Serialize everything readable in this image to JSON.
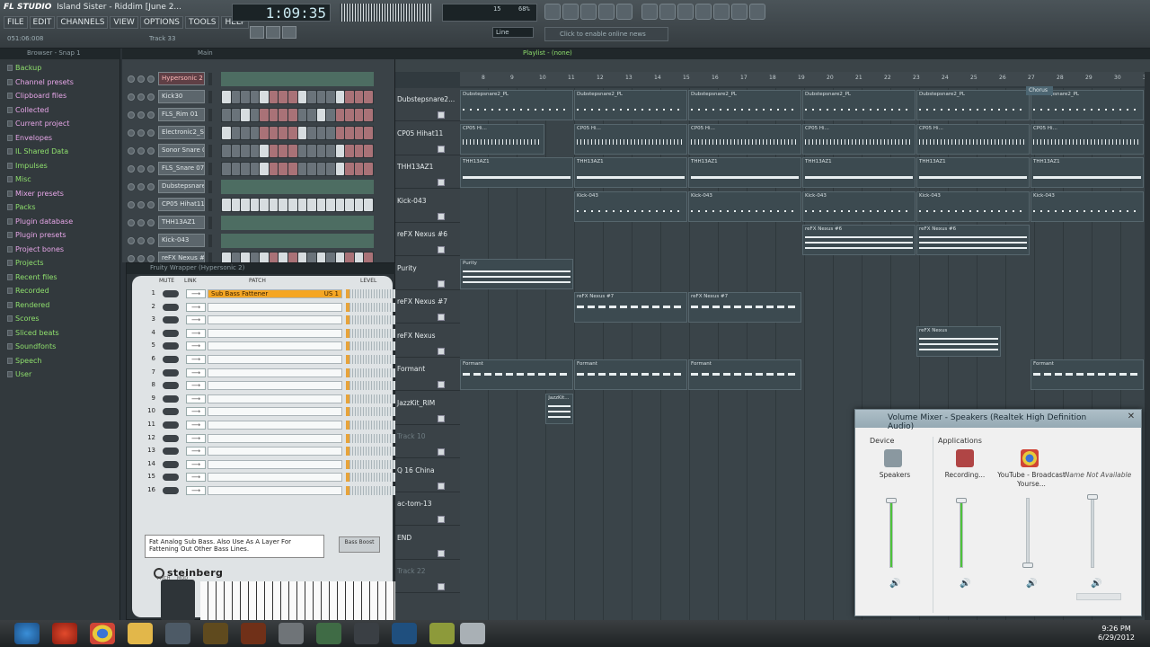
{
  "app": {
    "brand": "FL STUDIO",
    "title": "Island Sister - Riddim [June 2...",
    "time": "1:09:35",
    "status_left": "051:06:008",
    "track_label": "Track 33",
    "hint": "Click to enable online news",
    "mode": "Line",
    "meter_top": "15",
    "meter_right": "68%"
  },
  "menu": [
    "FILE",
    "EDIT",
    "CHANNELS",
    "VIEW",
    "OPTIONS",
    "TOOLS",
    "HELP"
  ],
  "browser": {
    "title": "Browser - Snap 1",
    "items": [
      "Backup",
      "Channel presets",
      "Clipboard files",
      "Collected",
      "Current project",
      "Envelopes",
      "IL Shared Data",
      "Impulses",
      "Misc",
      "Mixer presets",
      "Packs",
      "Plugin database",
      "Plugin presets",
      "Project bones",
      "Projects",
      "Recent files",
      "Recorded",
      "Rendered",
      "Scores",
      "Sliced beats",
      "Soundfonts",
      "Speech",
      "User"
    ]
  },
  "rack": {
    "title": "Main",
    "channels": [
      "Hypersonic 2",
      "Kick30",
      "FLS_Rim 01",
      "Electronic2_S...",
      "Sonor Snare 0...",
      "FLS_Snare 076",
      "Dubstepsnare...",
      "CP05 Hihat11",
      "THH13AZ1",
      "Kick-043",
      "reFX Nexus #6"
    ]
  },
  "plugin": {
    "title": "Fruity Wrapper (Hypersonic 2)",
    "col_mute": "MUTE",
    "col_link": "LINK",
    "col_patch": "PATCH",
    "col_level": "LEVEL",
    "slot1_patch": "Sub Bass Fattener",
    "slot1_bank": "US 1",
    "description": "Fat Analog Sub Bass. Also Use As A Layer For Fattening Out Other Bass Lines.",
    "preset_button": "Bass Boost",
    "logo": "steinberg",
    "pitch_label": "PITCH",
    "mod_label": "MOD",
    "slot_numbers": [
      "1",
      "2",
      "3",
      "4",
      "5",
      "6",
      "7",
      "8",
      "9",
      "10",
      "11",
      "12",
      "13",
      "14",
      "15",
      "16"
    ]
  },
  "playlist": {
    "title": "Playlist - (none)",
    "marker": "Chorus",
    "ruler": [
      "8",
      "9",
      "10",
      "11",
      "12",
      "13",
      "14",
      "15",
      "16",
      "17",
      "18",
      "19",
      "20",
      "21",
      "22",
      "23",
      "24",
      "25",
      "26",
      "27",
      "28",
      "29",
      "30",
      "31",
      "32"
    ],
    "tracks": [
      "Dubstepsnare2...",
      "CP05 Hihat11",
      "THH13AZ1",
      "Kick-043",
      "reFX Nexus #6",
      "Purity",
      "reFX Nexus #7",
      "reFX Nexus",
      "Formant",
      "JazzKit_RIM",
      "Track 10",
      "Q 16 China",
      "ac-tom-13",
      "END",
      "Track 22"
    ],
    "clip_labels": {
      "snare": "Dubstepsnare2_PL",
      "hihat": "CP05 Hi...",
      "thh": "THH13AZ1",
      "kick": "Kick-043",
      "nexus6": "reFX Nexus #6",
      "purity": "Purity",
      "nexus7": "reFX Nexus #7",
      "nexus": "reFX Nexus",
      "formant": "Formant",
      "jazz": "JazzKit..."
    }
  },
  "mixer": {
    "title": "Volume Mixer - Speakers (Realtek High Definition Audio)",
    "device_label": "Device",
    "apps_label": "Applications",
    "channels": [
      {
        "name": "Speakers",
        "level": 0.95
      },
      {
        "name": "Recording...",
        "level": 0.95
      },
      {
        "name": "YouTube - Broadcast Yourse...",
        "level": 0.0
      },
      {
        "name": "Name Not Available",
        "level": 1.0
      }
    ]
  },
  "taskbar": {
    "time": "9:26 PM",
    "date": "6/29/2012"
  },
  "colors": {
    "accent_green": "#8fe06d",
    "folder_pink": "#e7a6e8",
    "meter_green": "#4ec23b",
    "patch_orange": "#f5a623"
  }
}
